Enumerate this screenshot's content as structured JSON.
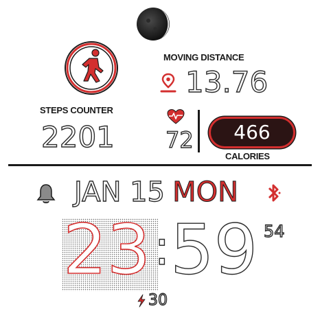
{
  "steps": {
    "label": "STEPS COUNTER",
    "value": "2201"
  },
  "distance": {
    "label": "MOVING DISTANCE",
    "value": "13.76"
  },
  "heart": {
    "value": "72"
  },
  "calories": {
    "value": "466",
    "label": "CALORIES"
  },
  "date": {
    "month_day": "JAN 15",
    "weekday": "MON"
  },
  "time": {
    "hours": "23",
    "separator": ":",
    "minutes": "59",
    "seconds": "54"
  },
  "battery": {
    "value": "30"
  },
  "colors": {
    "accent": "#d32f2f",
    "dark": "#2b1414",
    "text": "#1a1a1a"
  },
  "icons": [
    "moon-phase-icon",
    "walking-person-icon",
    "location-pin-icon",
    "heart-rate-icon",
    "bell-icon",
    "bluetooth-icon",
    "lightning-icon"
  ]
}
